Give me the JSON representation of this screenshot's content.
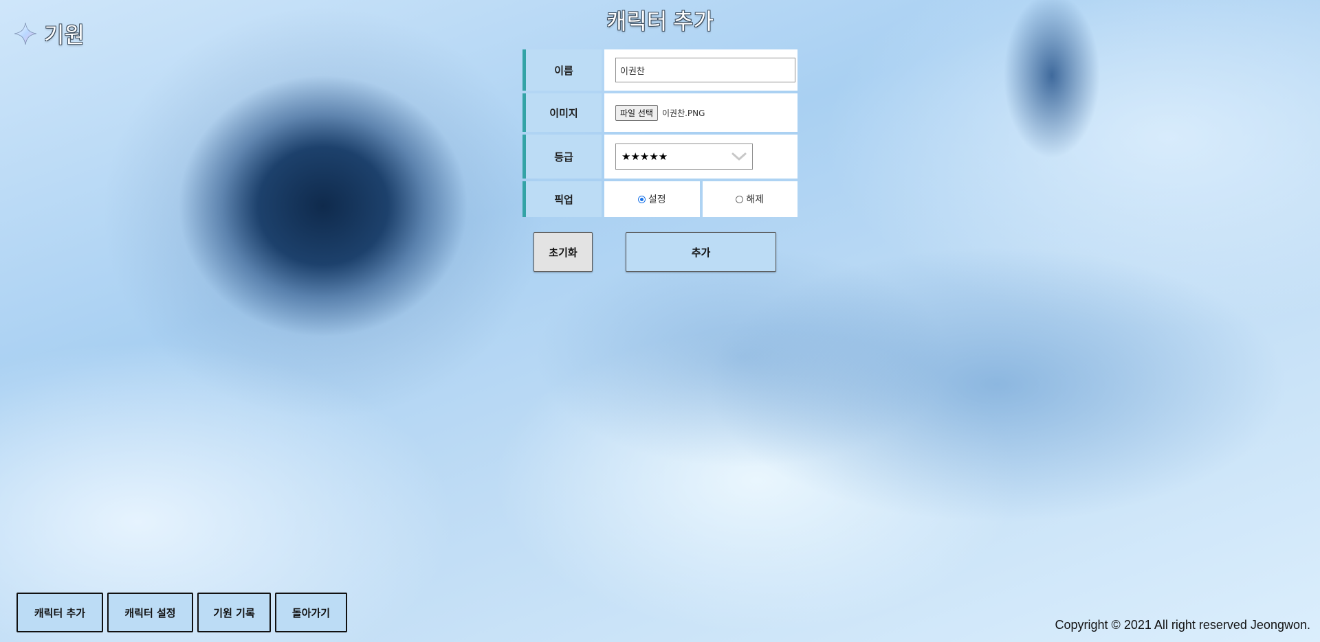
{
  "header": {
    "logo_text": "기원",
    "logo_icon": "sparkle-star-icon",
    "title": "캐릭터 추가"
  },
  "form": {
    "name": {
      "label": "이름",
      "value": "이권찬",
      "placeholder": ""
    },
    "image": {
      "label": "이미지",
      "button_label": "파일 선택",
      "file_name": "이권찬.PNG"
    },
    "grade": {
      "label": "등급",
      "selected": "★★★★★",
      "icon": "chevron-down-icon"
    },
    "pickup": {
      "label": "픽업",
      "options": [
        {
          "label": "설정",
          "checked": true
        },
        {
          "label": "해제",
          "checked": false
        }
      ]
    }
  },
  "actions": {
    "reset_label": "초기화",
    "add_label": "추가"
  },
  "nav": {
    "items": [
      {
        "label": "캐릭터 추가"
      },
      {
        "label": "캐릭터 설정"
      },
      {
        "label": "기원 기록"
      },
      {
        "label": "돌아가기"
      }
    ]
  },
  "footer": {
    "copyright": "Copyright © 2021 All right reserved Jeongwon."
  },
  "colors": {
    "label_bg": "#bcdcf5",
    "accent_border": "#33a3a6",
    "reset_bg": "#e3e3e3"
  }
}
